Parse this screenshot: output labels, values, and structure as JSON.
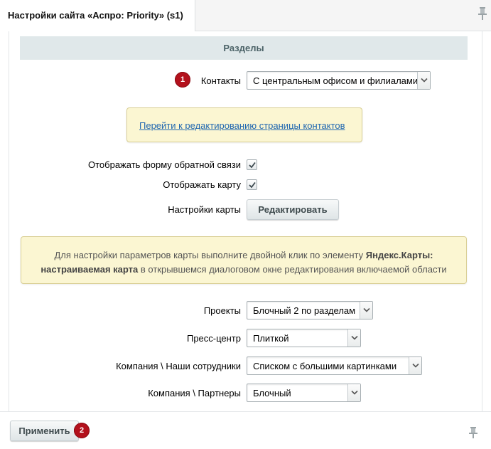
{
  "tab": {
    "title": "Настройки сайта «Аспро: Priority» (s1)"
  },
  "section": {
    "title": "Разделы"
  },
  "contacts": {
    "badge": "1",
    "label": "Контакты",
    "value": "С центральным офисом и филиалами"
  },
  "contacts_note": {
    "link_text": "Перейти к редактированию страницы контактов"
  },
  "feedback_form": {
    "label": "Отображать форму обратной связи",
    "checked": true
  },
  "show_map": {
    "label": "Отображать карту",
    "checked": true
  },
  "map_settings": {
    "label": "Настройки карты",
    "button_label": "Редактировать"
  },
  "map_info": {
    "text_1": "Для настройки параметров карты выполните двойной клик по элементу",
    "bold": "Яндекс.Карты: настраиваемая карта",
    "text_2": "в открывшемся диалоговом окне редактирования включаемой области"
  },
  "fields": [
    {
      "label": "Проекты",
      "value": "Блочный 2 по разделам"
    },
    {
      "label": "Пресс-центр",
      "value": "Плиткой"
    },
    {
      "label": "Компания \\ Наши сотрудники",
      "value": "Списком с большими картинками"
    },
    {
      "label": "Компания \\ Партнеры",
      "value": "Блочный"
    }
  ],
  "footer": {
    "apply_label": "Применить",
    "badge": "2"
  },
  "colors": {
    "badge": "#b3111c",
    "section_header_bg": "#e0e8ea",
    "note_bg": "#fbf6d2",
    "link": "#2067b0"
  }
}
